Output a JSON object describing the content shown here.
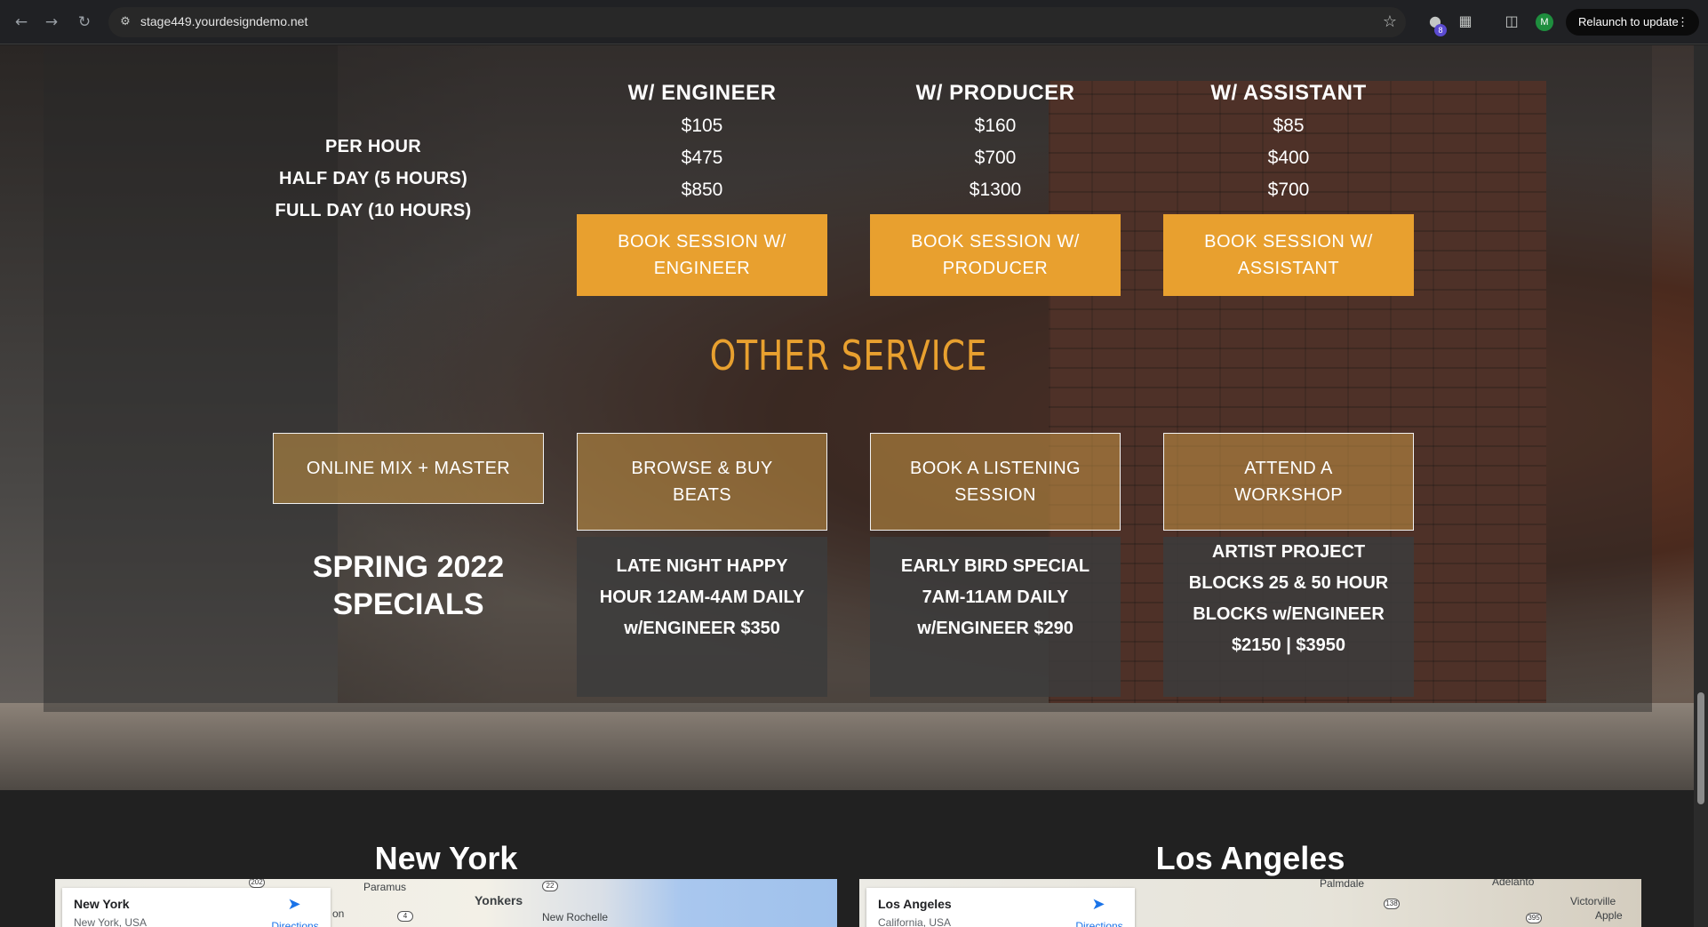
{
  "browser": {
    "url": "stage449.yourdesigndemo.net",
    "extension_badge": "8",
    "avatar_letter": "M",
    "relaunch_label": "Relaunch to update"
  },
  "pricing": {
    "row_labels": [
      "PER HOUR",
      "HALF DAY (5 HOURS)",
      "FULL DAY (10 HOURS)"
    ],
    "columns": [
      {
        "title": "W/ ENGINEER",
        "prices": [
          "$105",
          "$475",
          "$850"
        ],
        "button": "BOOK SESSION W/ ENGINEER"
      },
      {
        "title": "W/ PRODUCER",
        "prices": [
          "$160",
          "$700",
          "$1300"
        ],
        "button": "BOOK SESSION W/ PRODUCER"
      },
      {
        "title": "W/ ASSISTANT",
        "prices": [
          "$85",
          "$400",
          "$700"
        ],
        "button": "BOOK SESSION W/ ASSISTANT"
      }
    ]
  },
  "other_service": {
    "title": "OTHER SERVICE",
    "items": [
      "ONLINE MIX + MASTER",
      "BROWSE &  BUY BEATS",
      "BOOK A LISTENING SESSION",
      "ATTEND A WORKSHOP"
    ]
  },
  "specials": {
    "title": "SPRING 2022 SPECIALS",
    "items": [
      "LATE NIGHT HAPPY HOUR 12AM-4AM DAILY w/ENGINEER $350",
      "EARLY BIRD  SPECIAL 7AM-11AM DAILY w/ENGINEER $290",
      "ARTIST PROJECT BLOCKS 25 & 50 HOUR BLOCKS w/ENGINEER $2150 | $3950"
    ]
  },
  "locations": [
    {
      "city": "New York",
      "map_name": "New York",
      "map_sub": "New York, USA",
      "directions": "Directions",
      "labels": [
        "Paramus",
        "Yonkers",
        "New Rochelle",
        "on"
      ],
      "shields": [
        "202",
        "22",
        "4"
      ]
    },
    {
      "city": "Los Angeles",
      "map_name": "Los Angeles",
      "map_sub": "California, USA",
      "directions": "Directions",
      "labels": [
        "Palmdale",
        "Adelanto",
        "Victorville",
        "Apple"
      ],
      "shields": [
        "138",
        "395"
      ]
    }
  ],
  "colors": {
    "accent": "#e8a02f",
    "chrome_bg": "#202124",
    "page_bg": "#212121"
  }
}
